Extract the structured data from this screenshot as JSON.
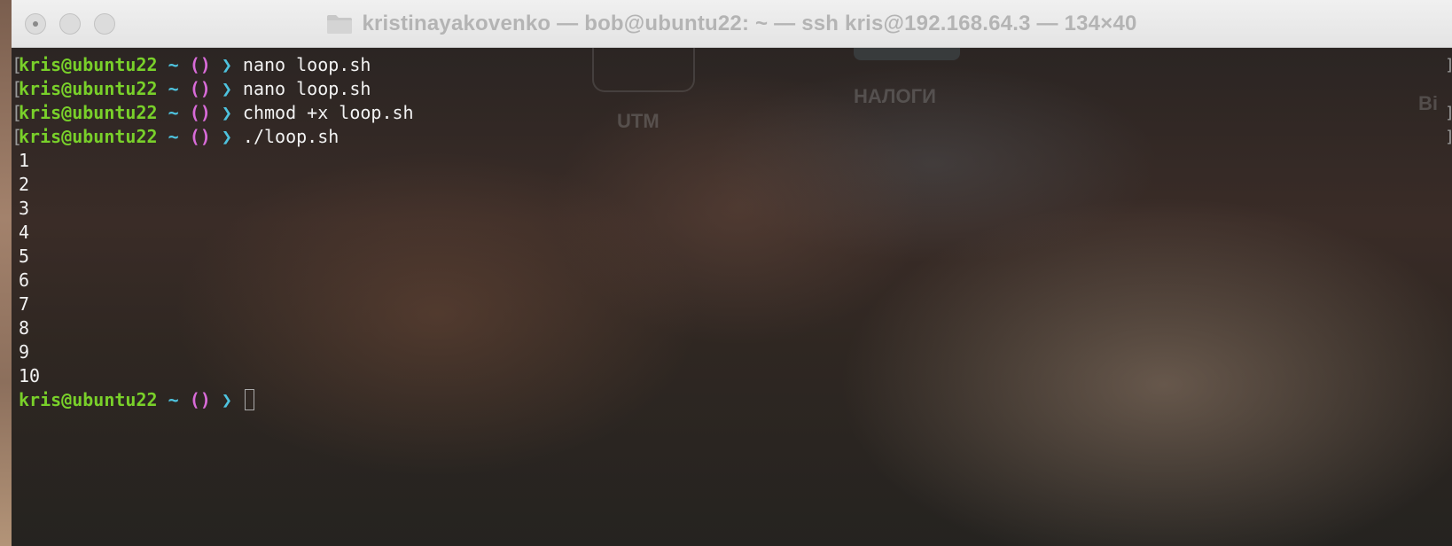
{
  "window": {
    "title": "kristinayakovenko — bob@ubuntu22: ~ — ssh kris@192.168.64.3 — 134×40",
    "title_icon": "folder-icon"
  },
  "background": {
    "labels": [
      "UTM",
      "НАЛОГИ",
      "Bi"
    ]
  },
  "prompt": {
    "user": "kris@ubuntu22",
    "dir": "~",
    "venv": "()",
    "arrow": "❯"
  },
  "history": [
    {
      "command": "nano loop.sh"
    },
    {
      "command": "nano loop.sh"
    },
    {
      "command": "chmod +x loop.sh"
    },
    {
      "command": "./loop.sh"
    }
  ],
  "output": [
    "1",
    "2",
    "3",
    "4",
    "5",
    "6",
    "7",
    "8",
    "9",
    "10"
  ],
  "colors": {
    "user": "#79d02a",
    "dir": "#4ec3df",
    "venv": "#d86bd8",
    "arrow": "#4ec3df",
    "text": "#f2f2f2"
  }
}
